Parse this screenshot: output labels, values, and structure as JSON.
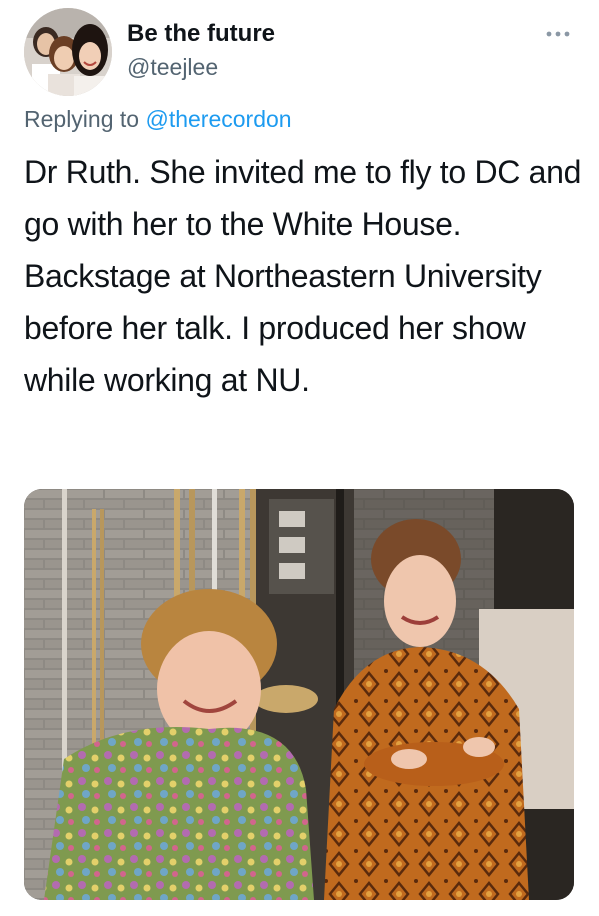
{
  "tweet": {
    "author": {
      "display_name": "Be the future",
      "handle": "@teejlee",
      "avatar_icon": "profile-photo"
    },
    "more_icon": "more-horizontal-icon",
    "reply": {
      "prefix": "Replying to",
      "mention": "@therecordon"
    },
    "text": "Dr Ruth. She invited me to fly to DC and go with her to the White House. Backstage at Northeastern University before her talk. I produced her show while working at NU.",
    "media": {
      "type": "photo"
    }
  },
  "colors": {
    "text_primary": "#0f1419",
    "text_secondary": "#536471",
    "link": "#1d9bf0",
    "background": "#ffffff"
  }
}
